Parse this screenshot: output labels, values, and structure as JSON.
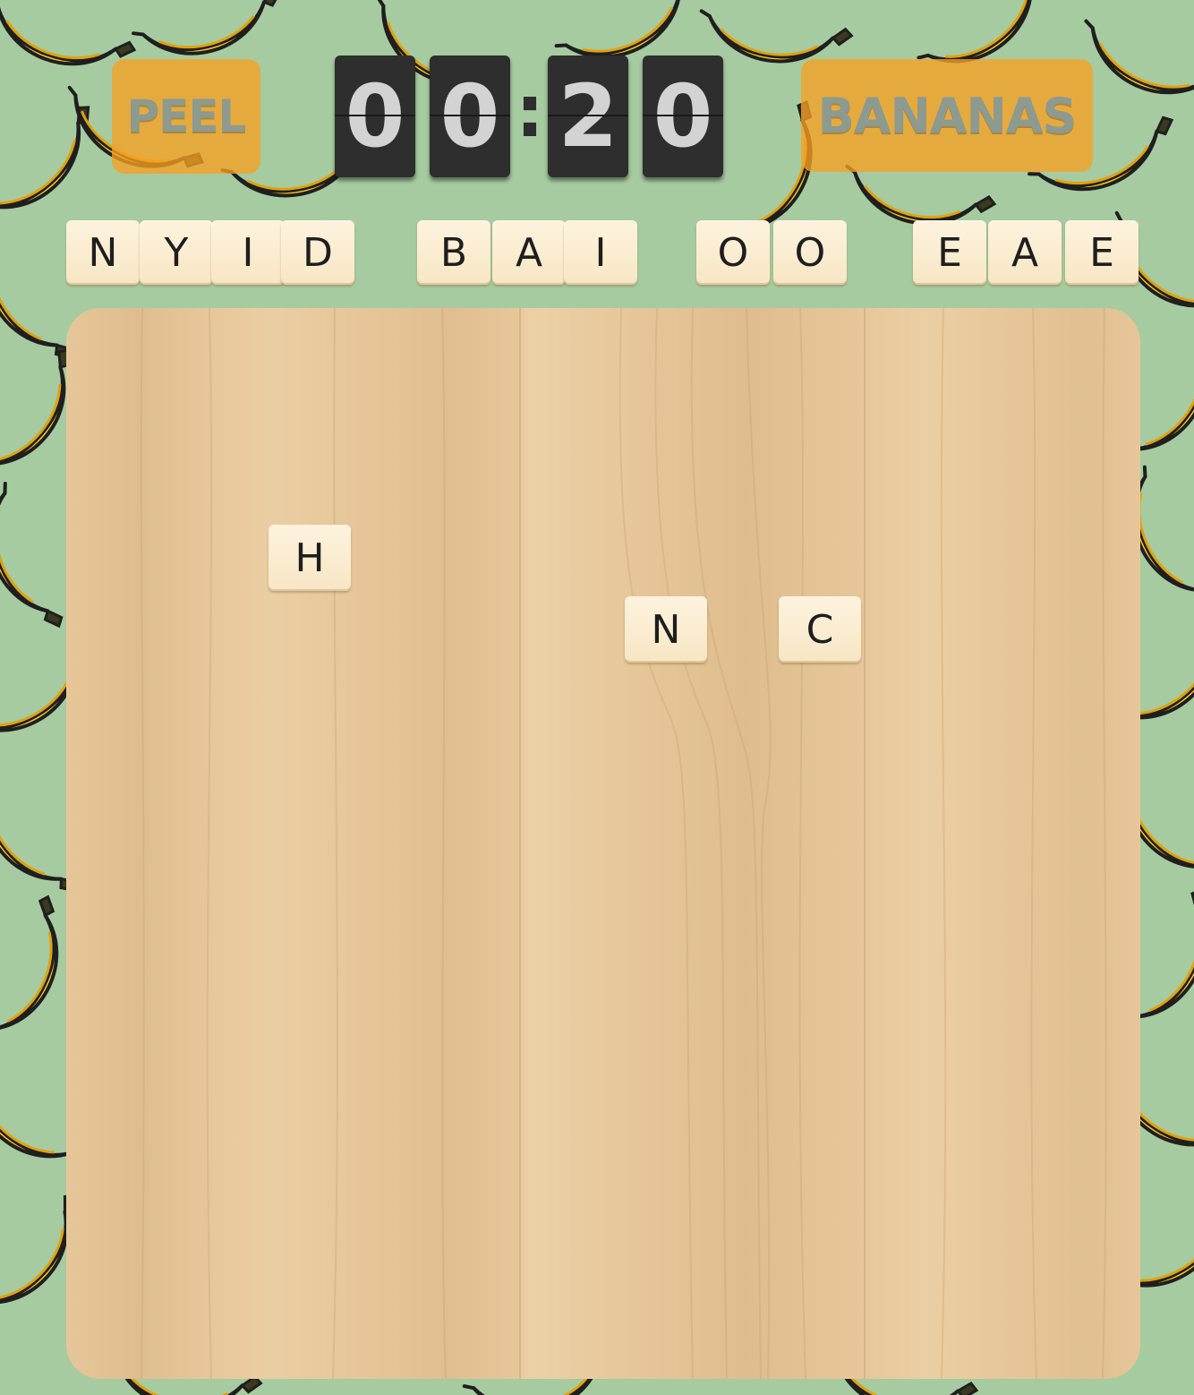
{
  "controls": {
    "peel_label": "PEEL",
    "bananas_label": "BANANAS"
  },
  "timer": {
    "digits": [
      "0",
      "0",
      "2",
      "0"
    ],
    "separator": ":"
  },
  "hand_tiles": [
    "N",
    "Y",
    "I",
    "D",
    "B",
    "A",
    "I",
    "O",
    "O",
    "E",
    "A",
    "E"
  ],
  "board_tiles": [
    "H",
    "N",
    "C"
  ],
  "colors": {
    "background": "#a6cba0",
    "button": "#f7a023",
    "tile": "#fbeed3",
    "flip_card": "#2e2e2e",
    "board_wood": "#e6c698"
  }
}
